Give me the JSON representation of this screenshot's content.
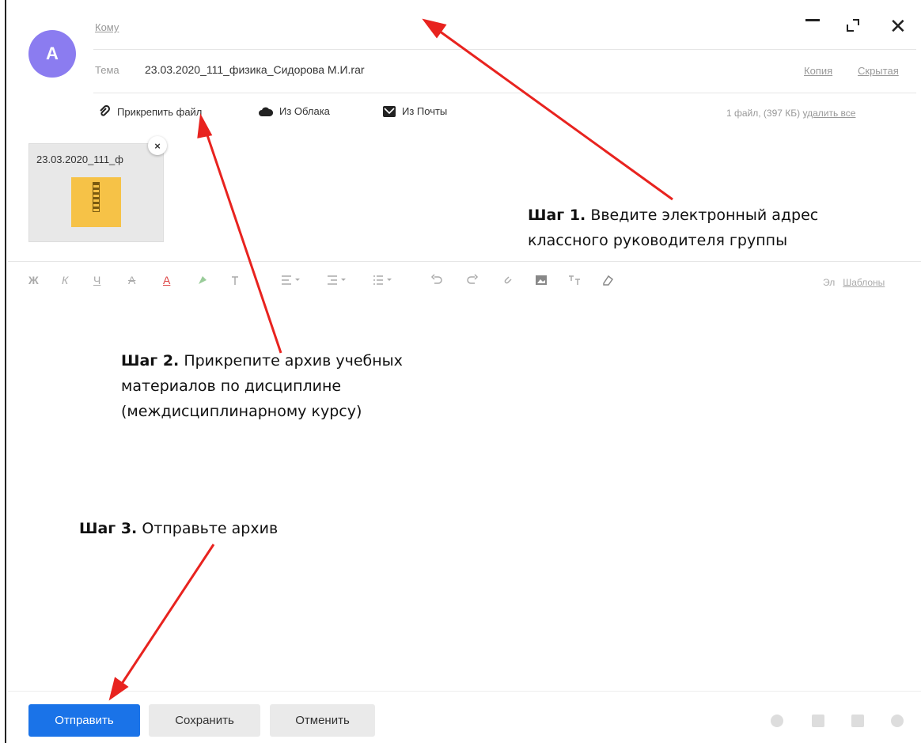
{
  "avatar": {
    "letter": "А"
  },
  "header": {
    "to_label": "Кому",
    "subject_label": "Тема",
    "subject_value": "23.03.2020_111_физика_Сидорова М.И.rar",
    "copy_link": "Копия",
    "hidden_link": "Скрытая",
    "window_controls": {
      "close": "✕"
    }
  },
  "attach_bar": {
    "attach_file": "Прикрепить файл",
    "from_cloud": "Из Облака",
    "from_mail": "Из Почты",
    "file_info": "1 файл, (397 КБ)",
    "delete_all": "удалить все"
  },
  "attachment": {
    "name": "23.03.2020_111_ф",
    "remove": "×"
  },
  "toolbar": {
    "bold": "Ж",
    "italic": "К",
    "underline": "Ч",
    "strike": "А",
    "text_color": "А",
    "templates_prefix": "Эл",
    "templates": "Шаблоны"
  },
  "notes": {
    "step1_title": "Шаг 1.",
    "step1_text": " Введите электронный адрес классного руководителя группы",
    "step2_title": "Шаг 2.",
    "step2_text": " Прикрепите архив учебных материалов по дисциплине (междисциплинарному курсу)",
    "step3_title": "Шаг 3.",
    "step3_text": " Отправьте архив"
  },
  "buttons": {
    "send": "Отправить",
    "save": "Сохранить",
    "cancel": "Отменить"
  },
  "colors": {
    "accent": "#1a73e8",
    "avatar": "#8b7cf0",
    "annotation_arrow": "#e8231f",
    "zip": "#f6c247"
  }
}
